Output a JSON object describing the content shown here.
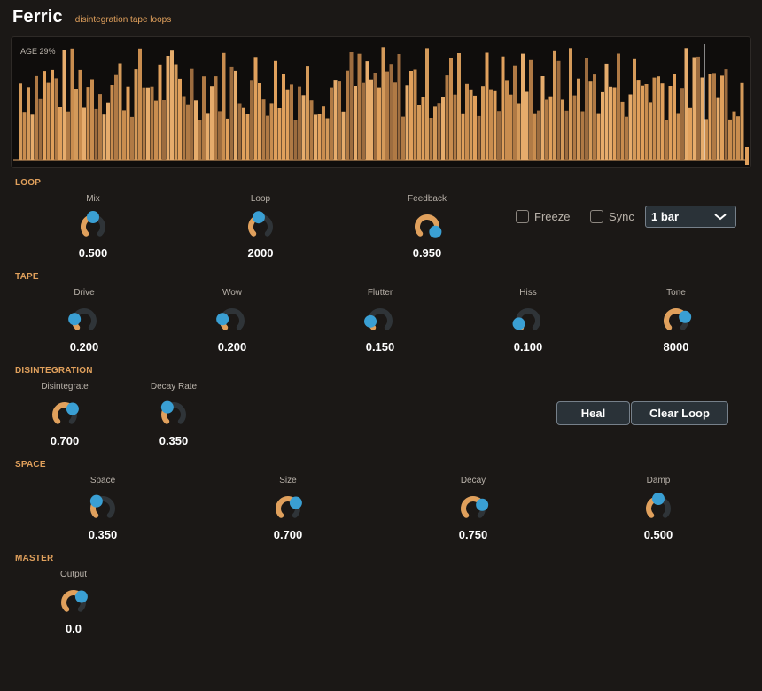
{
  "header": {
    "title": "Ferric",
    "subtitle": "disintegration tape loops"
  },
  "waveform": {
    "age_label": "AGE 29%",
    "age_percent": 29,
    "bar_color": "#e0a05c",
    "playhead_color": "#ffffff"
  },
  "sections": {
    "loop": "LOOP",
    "tape": "TAPE",
    "disintegration": "DISINTEGRATION",
    "space": "SPACE",
    "master": "MASTER"
  },
  "loop": {
    "knobs": [
      {
        "label": "Mix",
        "value": "0.500",
        "level": 0.5
      },
      {
        "label": "Loop",
        "value": "2000",
        "level": 0.46
      },
      {
        "label": "Feedback",
        "value": "0.950",
        "level": 0.95
      }
    ],
    "freeze_label": "Freeze",
    "freeze_checked": false,
    "sync_label": "Sync",
    "sync_checked": false,
    "division": "1 bar"
  },
  "tape": {
    "knobs": [
      {
        "label": "Drive",
        "value": "0.200",
        "level": 0.2
      },
      {
        "label": "Wow",
        "value": "0.200",
        "level": 0.2
      },
      {
        "label": "Flutter",
        "value": "0.150",
        "level": 0.15
      },
      {
        "label": "Hiss",
        "value": "0.100",
        "level": 0.1
      },
      {
        "label": "Tone",
        "value": "8000",
        "level": 0.75
      }
    ]
  },
  "disintegration": {
    "knobs": [
      {
        "label": "Disintegrate",
        "value": "0.700",
        "level": 0.7
      },
      {
        "label": "Decay Rate",
        "value": "0.350",
        "level": 0.35
      }
    ],
    "heal_label": "Heal",
    "clear_label": "Clear Loop"
  },
  "space": {
    "knobs": [
      {
        "label": "Space",
        "value": "0.350",
        "level": 0.35
      },
      {
        "label": "Size",
        "value": "0.700",
        "level": 0.7
      },
      {
        "label": "Decay",
        "value": "0.750",
        "level": 0.75
      },
      {
        "label": "Damp",
        "value": "0.500",
        "level": 0.5
      }
    ]
  },
  "master": {
    "knobs": [
      {
        "label": "Output",
        "value": "0.0",
        "level": 0.7
      }
    ]
  },
  "colors": {
    "accent": "#e0a05c",
    "knob_pointer": "#3a9fd3",
    "knob_track": "#2f3438"
  }
}
